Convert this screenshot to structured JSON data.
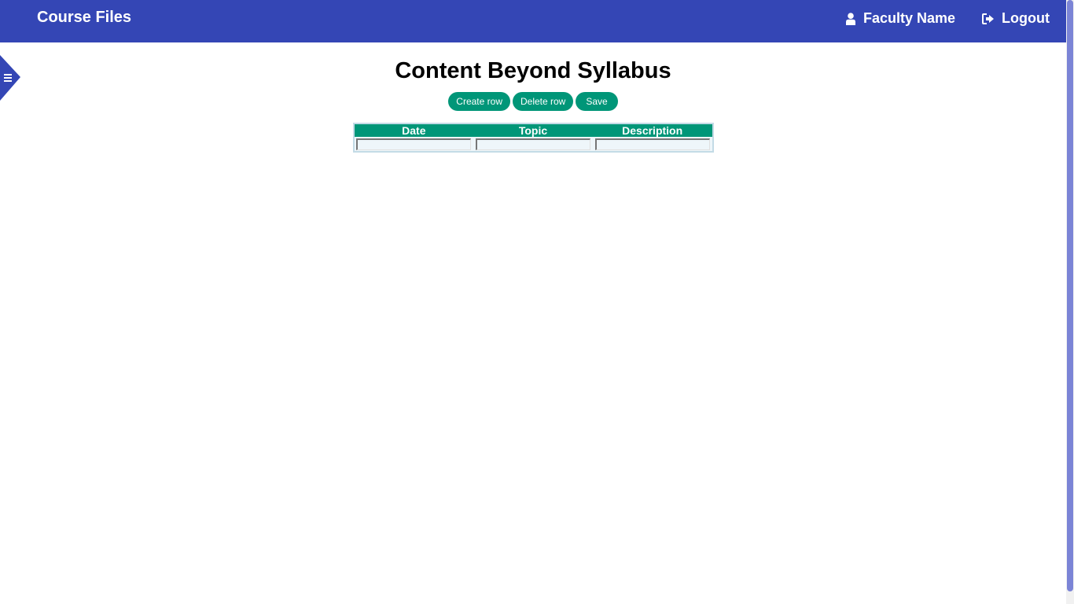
{
  "header": {
    "brand": "Course Files",
    "user_label": "Faculty Name",
    "logout_label": "Logout"
  },
  "colors": {
    "navbar": "#3446b5",
    "accent": "#009678"
  },
  "icons": {
    "user": "user-icon",
    "logout": "logout-icon",
    "menu": "menu-icon"
  },
  "main": {
    "title": "Content Beyond Syllabus",
    "buttons": {
      "create_row": "Create row",
      "delete_row": "Delete row",
      "save": "Save"
    },
    "table": {
      "columns": [
        "Date",
        "Topic",
        "Description"
      ],
      "rows": [
        [
          "",
          "",
          ""
        ]
      ]
    }
  }
}
